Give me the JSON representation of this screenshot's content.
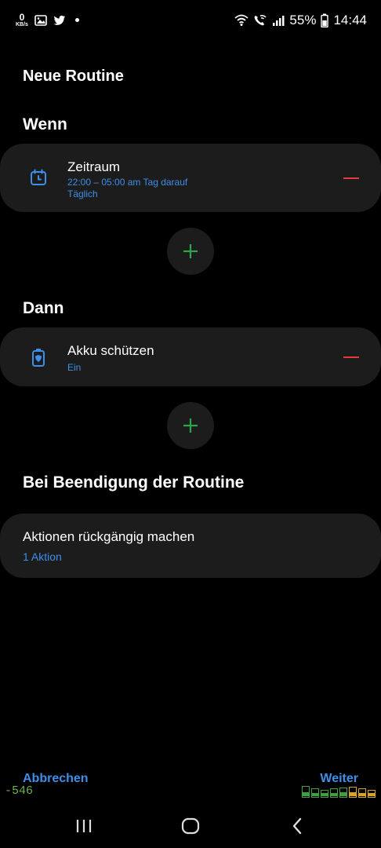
{
  "status_bar": {
    "net_speed_value": "0",
    "net_speed_unit": "KB/s",
    "battery": "55%",
    "time": "14:44"
  },
  "page_title": "Neue Routine",
  "if_section": {
    "heading": "Wenn",
    "condition": {
      "title": "Zeitraum",
      "line1": "22:00 – 05:00 am Tag darauf",
      "line2": "Täglich"
    }
  },
  "then_section": {
    "heading": "Dann",
    "action": {
      "title": "Akku schützen",
      "line1": "Ein"
    }
  },
  "end_section": {
    "heading": "Bei Beendigung der Routine",
    "card_title": "Aktionen rückgängig machen",
    "card_sub": "1 Aktion"
  },
  "footer": {
    "cancel": "Abbrechen",
    "next": "Weiter"
  },
  "overlay": {
    "value": "-546",
    "bars": [
      {
        "level": 0.75,
        "color": "#3fa03f"
      },
      {
        "level": 0.6,
        "color": "#3fa03f"
      },
      {
        "level": 0.45,
        "color": "#3fa03f"
      },
      {
        "level": 0.55,
        "color": "#3fa03f"
      },
      {
        "level": 0.65,
        "color": "#3fa03f"
      },
      {
        "level": 0.7,
        "color": "#d8a521"
      },
      {
        "level": 0.6,
        "color": "#d8a521"
      },
      {
        "level": 0.45,
        "color": "#d8a521"
      }
    ]
  },
  "colors": {
    "accent": "#3e8fe9",
    "remove": "#e33b3b",
    "add": "#2fa54a",
    "card": "#1c1c1c"
  }
}
